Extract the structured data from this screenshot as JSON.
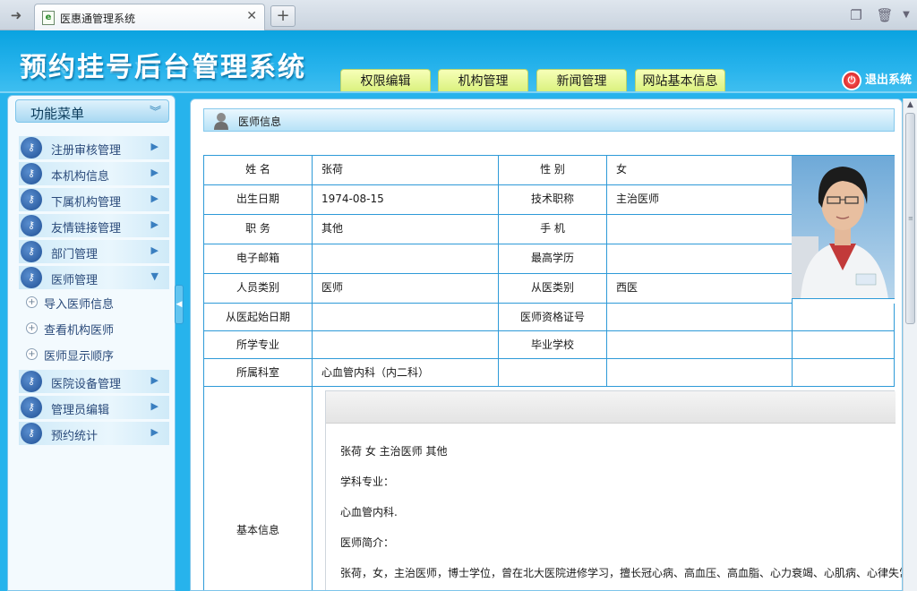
{
  "browser": {
    "tab_title": "医惠通管理系统",
    "tab_close": "✕",
    "new_tab": "+"
  },
  "header": {
    "site_title": "预约挂号后台管理系统",
    "nav_tabs": [
      "权限编辑",
      "机构管理",
      "新闻管理",
      "网站基本信息"
    ],
    "logout_label": "退出系统"
  },
  "sidebar": {
    "title": "功能菜单",
    "items": [
      {
        "label": "注册审核管理"
      },
      {
        "label": "本机构信息"
      },
      {
        "label": "下属机构管理"
      },
      {
        "label": "友情链接管理"
      },
      {
        "label": "部门管理"
      },
      {
        "label": "医师管理"
      },
      {
        "label": "医院设备管理"
      },
      {
        "label": "管理员编辑"
      },
      {
        "label": "预约统计"
      }
    ],
    "sub_items": [
      {
        "label": "导入医师信息"
      },
      {
        "label": "查看机构医师"
      },
      {
        "label": "医师显示顺序"
      }
    ]
  },
  "panel": {
    "title": "医师信息"
  },
  "doctor": {
    "name_label": "姓    名",
    "name": "张荷",
    "gender_label": "性    别",
    "gender": "女",
    "birth_label": "出生日期",
    "birth": "1974-08-15",
    "tech_title_label": "技术职称",
    "tech_title": "主治医师",
    "position_label": "职    务",
    "position": "其他",
    "mobile_label": "手    机",
    "mobile": "",
    "email_label": "电子邮箱",
    "email": "",
    "education_label": "最高学历",
    "education": "",
    "staff_type_label": "人员类别",
    "staff_type": "医师",
    "medicine_type_label": "从医类别",
    "medicine_type": "西医",
    "start_date_label": "从医起始日期",
    "start_date": "",
    "cert_label": "医师资格证号",
    "cert": "",
    "major_label": "所学专业",
    "major": "",
    "school_label": "毕业学校",
    "school": "",
    "department_label": "所属科室",
    "department": "心血管内科（内二科）",
    "basic_info_label": "基本信息"
  },
  "editor": {
    "line1": "张荷   女   主治医师   其他",
    "line2": "学科专业：",
    "line3": "心血管内科.",
    "line4": "医师简介：",
    "line5": "张荷，女，主治医师，博士学位，曾在北大医院进修学习，擅长冠心病、高血压、高血脂、心力衰竭、心肌病、心律失常"
  }
}
